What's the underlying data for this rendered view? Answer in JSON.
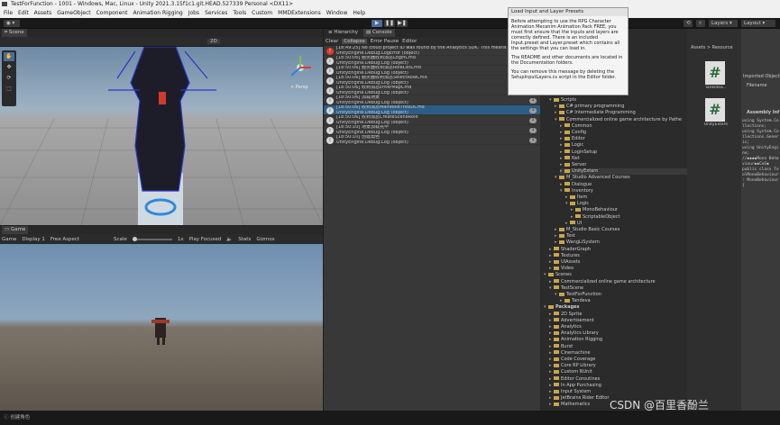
{
  "window": {
    "title": "TestForFunction - 1001 - Windows, Mac, Linux - Unity 2021.3.15f1c1.git.HEAD.527339 Personal <DX11>"
  },
  "menu": [
    "File",
    "Edit",
    "Assets",
    "GameObject",
    "Component",
    "Animation Rigging",
    "Jobs",
    "Services",
    "Tools",
    "Custom",
    "MMDExtensions",
    "Window",
    "Help"
  ],
  "toolbar": {
    "layers_label": "Layers",
    "layout_label": "Layout"
  },
  "scene": {
    "tab_label": "Scene",
    "persp_label": "< Persp",
    "toolbar_value": "2D"
  },
  "game": {
    "tab_label": "Game",
    "mode": "Game",
    "display": "Display 1",
    "aspect": "Free Aspect",
    "scale_label": "Scale",
    "scale_value": "1x",
    "play_focused": "Play Focused",
    "stats": "Stats",
    "gizmos": "Gizmos"
  },
  "console": {
    "hierarchy_tab": "Hierarchy",
    "console_tab": "Console",
    "clear": "Clear",
    "collapse": "Collapse",
    "error_pause": "Error Pause",
    "editor": "Editor",
    "logs": [
      {
        "line1": "[18:49:25] No cloud project ID was found by the Analytics SDK. This means",
        "line2": "UnityEngine.Debug:LogError (object)",
        "count": "1",
        "type": "error",
        "selected": false
      },
      {
        "line1": "[18:50:06] 服务器收到消息LoginCmd",
        "line2": "UnityEngine.Debug:Log (object)",
        "count": "1",
        "type": "info",
        "selected": false
      },
      {
        "line1": "[18:50:06] 服务器收到消息RoleListCmd",
        "line2": "UnityEngine.Debug:Log (object)",
        "count": "1",
        "type": "info",
        "selected": false
      },
      {
        "line1": "[18:50:06] 服务器收到消息SelectRoleCmd",
        "line2": "UnityEngine.Debug:Log (object)",
        "count": "1",
        "type": "info",
        "selected": false
      },
      {
        "line1": "[18:50:06] 收到消息EnterMapCmd",
        "line2": "UnityEngine.Debug:Log (object)",
        "count": "1",
        "type": "info",
        "selected": false
      },
      {
        "line1": "[18:50:06] 加载场景",
        "line2": "UnityEngine.Debug:Log (object)",
        "count": "1",
        "type": "info",
        "selected": false
      },
      {
        "line1": "[18:50:06] 收到消息MainRoleThisIDCmd",
        "line2": "UnityEngine.Debug:Log (object)",
        "count": "1",
        "type": "info",
        "selected": true
      },
      {
        "line1": "[18:50:06] 收到消息CreateSceneRole",
        "line2": "UnityEngine.Debug:Log (object)",
        "count": "1",
        "type": "info",
        "selected": false
      },
      {
        "line1": "[18:50:10] 场景加载完毕",
        "line2": "UnityEngine.Debug:Log (object)",
        "count": "1",
        "type": "info",
        "selected": false
      },
      {
        "line1": "[18:50:10] 创建角色",
        "line2": "UnityEngine.Debug:Log (object)",
        "count": "1",
        "type": "info",
        "selected": false
      }
    ]
  },
  "popup": {
    "title": "Load Input and Layer Presets",
    "body1": "Before attempting to use the RPG Character Animation Mecanim Animation Pack FREE, you must first ensure that the inputs and layers are correctly defined. There is an included Input.preset and Layer.preset which contains all the settings that you can load in.",
    "body2": "The README and other documents are located in the Documentation folders.",
    "body3": "You can remove this message by deleting the SetupInputLayers.cs script in the Editor folder."
  },
  "project": {
    "tree": [
      {
        "label": "Scripts",
        "depth": 1,
        "open": true
      },
      {
        "label": "C# primary programming",
        "depth": 2,
        "open": false
      },
      {
        "label": "C# Intermediate Programming",
        "depth": 2,
        "open": false
      },
      {
        "label": "Commercialized online game architecture by Pathe",
        "depth": 2,
        "open": true
      },
      {
        "label": "Common",
        "depth": 3,
        "open": false
      },
      {
        "label": "Config",
        "depth": 3,
        "open": false
      },
      {
        "label": "Editor",
        "depth": 3,
        "open": false
      },
      {
        "label": "Logic",
        "depth": 3,
        "open": false
      },
      {
        "label": "LoginSetup",
        "depth": 3,
        "open": false
      },
      {
        "label": "Net",
        "depth": 3,
        "open": false
      },
      {
        "label": "Server",
        "depth": 3,
        "open": false
      },
      {
        "label": "UnityExtern",
        "depth": 3,
        "open": false,
        "selected": true
      },
      {
        "label": "M_Studio Advanced Courses",
        "depth": 2,
        "open": true
      },
      {
        "label": "Dialogue",
        "depth": 3,
        "open": false
      },
      {
        "label": "Inventory",
        "depth": 3,
        "open": true
      },
      {
        "label": "Item",
        "depth": 4,
        "open": false
      },
      {
        "label": "Logic",
        "depth": 4,
        "open": true
      },
      {
        "label": "MonoBehaviour",
        "depth": 5,
        "open": false
      },
      {
        "label": "ScriptableObject",
        "depth": 5,
        "open": false
      },
      {
        "label": "UI",
        "depth": 4,
        "open": false
      },
      {
        "label": "M_Studio Basic Courses",
        "depth": 2,
        "open": false
      },
      {
        "label": "Test",
        "depth": 2,
        "open": false
      },
      {
        "label": "WangLiSystem",
        "depth": 2,
        "open": false
      },
      {
        "label": "ShaderGraph",
        "depth": 1,
        "open": false
      },
      {
        "label": "Textures",
        "depth": 1,
        "open": false
      },
      {
        "label": "UIAssets",
        "depth": 1,
        "open": false
      },
      {
        "label": "Video",
        "depth": 1,
        "open": false
      },
      {
        "label": "Scenes",
        "depth": 0,
        "open": true
      },
      {
        "label": "Commercialized online game architecture",
        "depth": 1,
        "open": false
      },
      {
        "label": "TestScene",
        "depth": 1,
        "open": true
      },
      {
        "label": "TestForFunction",
        "depth": 2,
        "open": true
      },
      {
        "label": "Tandeva",
        "depth": 3,
        "open": false
      },
      {
        "label": "Packages",
        "depth": 0,
        "open": true,
        "bold": true
      },
      {
        "label": "2D Sprite",
        "depth": 1,
        "open": false
      },
      {
        "label": "Advertisement",
        "depth": 1,
        "open": false
      },
      {
        "label": "Analytics",
        "depth": 1,
        "open": false
      },
      {
        "label": "Analytics Library",
        "depth": 1,
        "open": false
      },
      {
        "label": "Animation Rigging",
        "depth": 1,
        "open": false
      },
      {
        "label": "Burst",
        "depth": 1,
        "open": false
      },
      {
        "label": "Cinemachine",
        "depth": 1,
        "open": false
      },
      {
        "label": "Code Coverage",
        "depth": 1,
        "open": false
      },
      {
        "label": "Core RP Library",
        "depth": 1,
        "open": false
      },
      {
        "label": "Custom NUnit",
        "depth": 1,
        "open": false
      },
      {
        "label": "Editor Coroutines",
        "depth": 1,
        "open": false
      },
      {
        "label": "In App Purchasing",
        "depth": 1,
        "open": false
      },
      {
        "label": "Input System",
        "depth": 1,
        "open": false
      },
      {
        "label": "JetBrains Rider Editor",
        "depth": 1,
        "open": false
      },
      {
        "label": "Mathematics",
        "depth": 1,
        "open": false
      }
    ]
  },
  "assets": {
    "breadcrumb": "Assets > Resource",
    "items": [
      {
        "label": "TankIdea..."
      },
      {
        "label": "UnityExtern"
      }
    ]
  },
  "inspector": {
    "header": "Imported Object",
    "filename_label": "Filename",
    "assembly_label": "Assembly Inf",
    "code": "using System.Collections;\nusing System.Collections.Generic;\nusing UnityEngine;\n//◆◆◆◆Mono Behaviour◆◆CoG◆\npublic class ToolMonoBehaviour : MonoBehaviour\n{"
  },
  "status": {
    "text": "创建角色"
  },
  "watermark": "CSDN @百里香酚兰",
  "colors": {
    "console_selected": "#2c5d87",
    "error_icon": "#e0392f",
    "folder": "#c9a64a"
  }
}
